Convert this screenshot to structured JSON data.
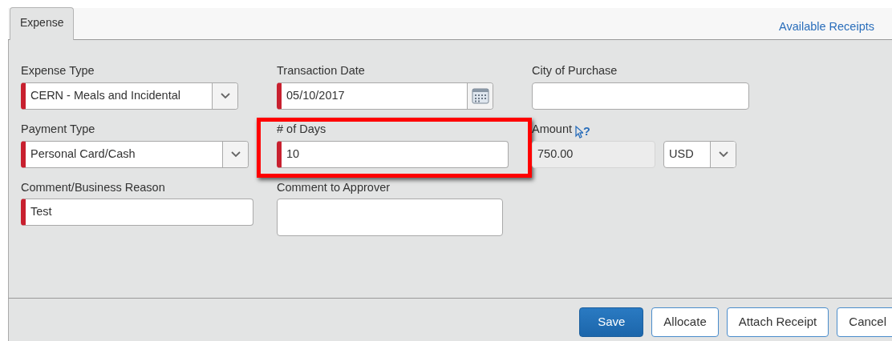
{
  "tabs": [
    {
      "label": "Expense",
      "selected": true
    }
  ],
  "link": "Available Receipts",
  "fields": [
    {
      "label": "Expense Type",
      "kind": "select",
      "value": "CERN - Meals and Incidental",
      "required": true,
      "highlighted": false,
      "disabled": false
    },
    {
      "label": "Transaction Date",
      "kind": "date",
      "value": "05/10/2017",
      "required": true,
      "highlighted": false,
      "disabled": false
    },
    {
      "label": "City of Purchase",
      "kind": "text",
      "required": false,
      "highlighted": false,
      "disabled": false
    },
    {
      "label": "Payment Type",
      "kind": "select",
      "value": "Personal Card/Cash",
      "required": true,
      "highlighted": false,
      "disabled": false
    },
    {
      "label": "# of Days",
      "kind": "text",
      "value": "10",
      "required": true,
      "highlighted": true,
      "disabled": false
    },
    {
      "label": "Amount",
      "kind": "currency",
      "value": "750.00",
      "currency": "USD",
      "help": "?",
      "required": false,
      "highlighted": false,
      "disabled": true
    },
    {
      "label": "Comment/Business Reason",
      "kind": "text",
      "value": "Test",
      "required": true,
      "highlighted": false,
      "disabled": false
    },
    {
      "label": "Comment to Approver",
      "kind": "textarea",
      "required": false,
      "highlighted": false,
      "disabled": false
    }
  ],
  "buttons": [
    {
      "label": "Save",
      "kind": "primary"
    },
    {
      "label": "Allocate",
      "kind": "secondary"
    },
    {
      "label": "Attach Receipt",
      "kind": "secondary"
    },
    {
      "label": "Cancel",
      "kind": "secondary"
    }
  ]
}
